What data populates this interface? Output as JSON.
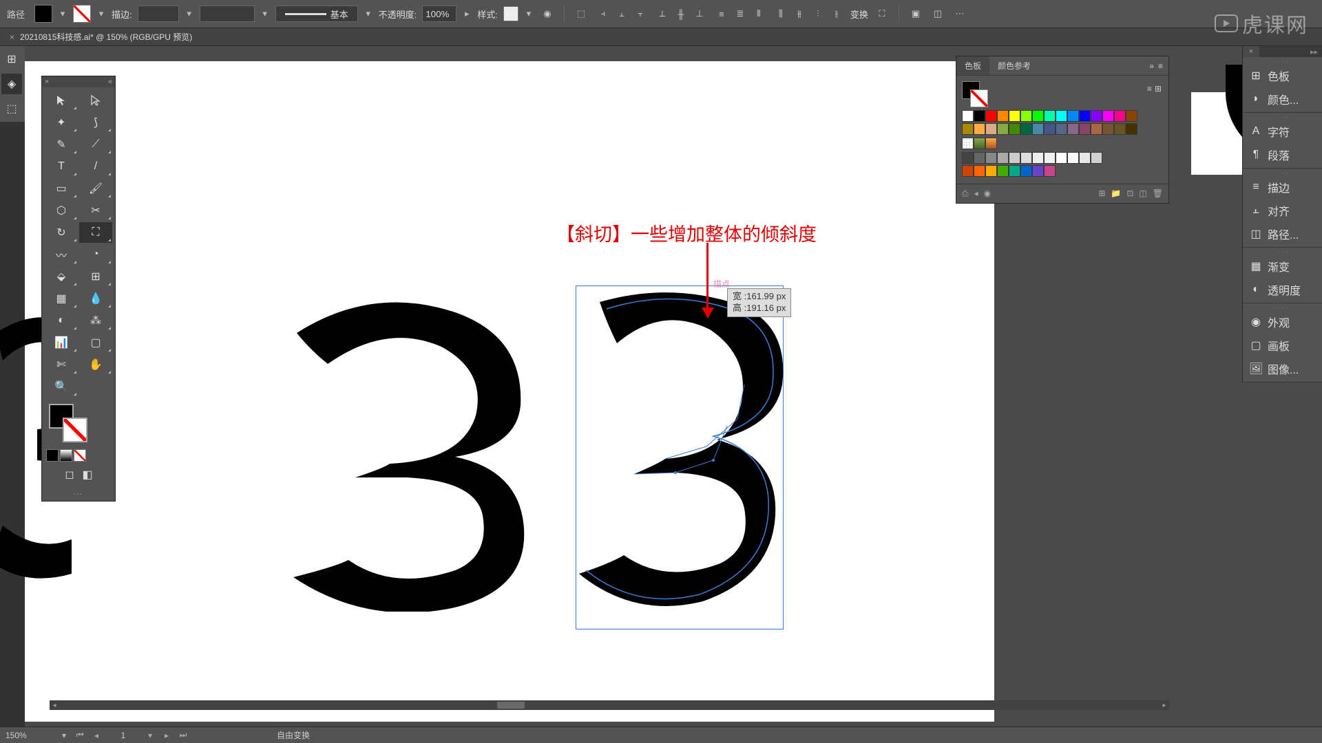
{
  "options": {
    "label": "路径",
    "stroke_label": "描边:",
    "brush_label": "基本",
    "opacity_label": "不透明度:",
    "opacity_value": "100%",
    "style_label": "样式:",
    "transform_label": "变换"
  },
  "tab": {
    "title": "20210815科技感.ai* @ 150% (RGB/GPU 预览)"
  },
  "annotation": {
    "text": "【斜切】一些增加整体的倾斜度",
    "anchor": "描点"
  },
  "tooltip": {
    "width_label": "宽",
    "width_value": "161.99 px",
    "height_label": "高",
    "height_value": "191.16 px"
  },
  "swatch": {
    "tab1": "色板",
    "tab2": "颜色参考",
    "colors_row1": [
      "#ffffff",
      "#000000",
      "#ff0000",
      "#ff8800",
      "#ffff00",
      "#88ff00",
      "#00ff00",
      "#00ffaa",
      "#00ffff",
      "#0088ff",
      "#0000ff",
      "#8800ff",
      "#ff00ff",
      "#ff0088",
      "#884400"
    ],
    "colors_row2": [
      "#aa8800",
      "#ffaa44",
      "#ddaa88",
      "#88aa44",
      "#448800",
      "#006644",
      "#4488aa",
      "#445588",
      "#556688",
      "#886688",
      "#884466",
      "#aa6644",
      "#775533",
      "#665522",
      "#443300"
    ],
    "colors_row3": [
      "#444444",
      "#666666",
      "#888888",
      "#aaaaaa",
      "#cccccc",
      "#dddddd",
      "#eeeeee",
      "#f0f0f0",
      "#ffffff",
      "#fafafa",
      "#e8e8e8",
      "#d0d0d0"
    ],
    "colors_row4": [
      "#cc4400",
      "#ff6600",
      "#ffaa00",
      "#44aa00",
      "#00aa88",
      "#0066cc",
      "#6644cc",
      "#cc4488"
    ]
  },
  "dock": {
    "color_panel": "色板",
    "color": "颜色...",
    "character": "字符",
    "paragraph": "段落",
    "stroke": "描边",
    "align": "对齐",
    "pathfinder": "路径...",
    "gradient": "渐变",
    "transparency": "透明度",
    "appearance": "外观",
    "artboards": "画板",
    "image": "图像..."
  },
  "status": {
    "zoom": "150%",
    "artboard": "1",
    "tool_hint": "自由变换"
  },
  "watermark": "虎课网",
  "chart_data": null
}
